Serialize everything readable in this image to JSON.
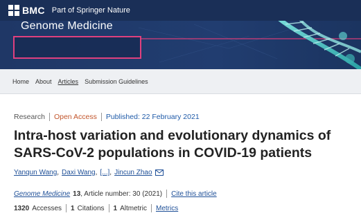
{
  "brand": {
    "logo_text": "BMC",
    "tagline": "Part of Springer Nature"
  },
  "journal": {
    "title": "Genome Medicine"
  },
  "nav": {
    "items": [
      {
        "label": "Home"
      },
      {
        "label": "About"
      },
      {
        "label": "Articles",
        "active": true
      },
      {
        "label": "Submission Guidelines"
      }
    ]
  },
  "article": {
    "type": "Research",
    "access": "Open Access",
    "published": "Published: 22 February 2021",
    "title": "Intra-host variation and evolutionary dynamics of SARS-CoV-2 populations in COVID-19 patients",
    "authors": {
      "first": "Yanqun Wang",
      "second": "Daxi Wang",
      "more": "[...]",
      "last": "Jincun Zhao",
      "comma": ","
    },
    "citation": {
      "journal": "Genome Medicine",
      "volume": "13",
      "details": ", Article number: 30 (2021)",
      "cite_link": "Cite this article"
    },
    "metrics": {
      "accesses_count": "1320",
      "accesses_label": "Accesses",
      "citations_count": "1",
      "citations_label": "Citations",
      "altmetric_count": "1",
      "altmetric_label": "Altmetric",
      "metrics_link": "Metrics"
    }
  },
  "colors": {
    "topbar": "#1a2f57",
    "banner": "#213a6a",
    "accent_pink": "#e0407e",
    "link_blue": "#1e4f97",
    "open_access_orange": "#c2552b"
  }
}
